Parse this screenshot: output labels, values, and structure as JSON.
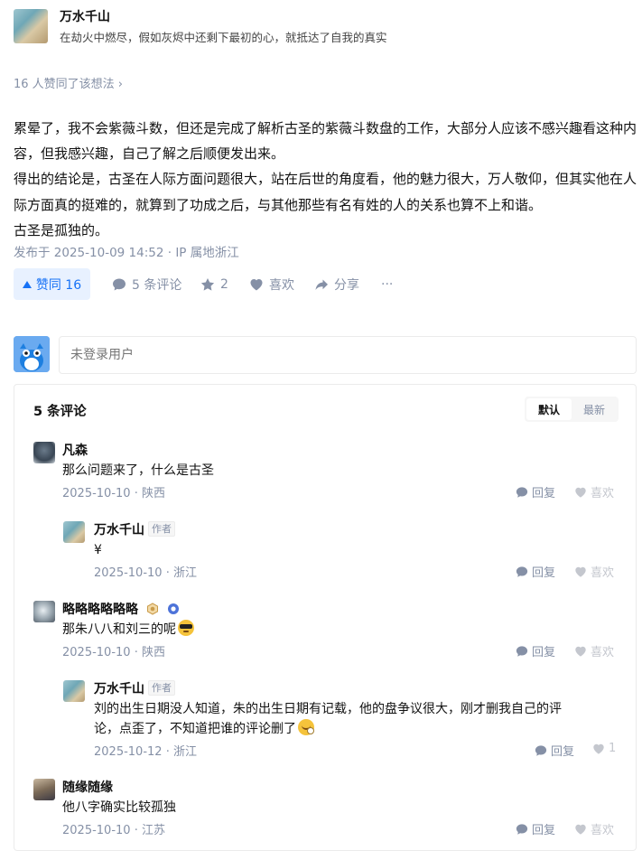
{
  "author": {
    "name": "万水千山",
    "bio": "在劫火中燃尽，假如灰烬中还剩下最初的心，就抵达了自我的真实"
  },
  "likers_text": "16 人赞同了该想法 ›",
  "content": {
    "p1": "累晕了，我不会紫薇斗数，但还是完成了解析古圣的紫薇斗数盘的工作，大部分人应该不感兴趣看这种内容，但我感兴趣，自己了解之后顺便发出来。",
    "p2": "得出的结论是，古圣在人际方面问题很大，站在后世的角度看，他的魅力很大，万人敬仰，但其实他在人际方面真的挺难的，就算到了功成之后，与其他那些有名有姓的人的关系也算不上和谐。",
    "p3": "古圣是孤独的。"
  },
  "meta": "发布于 2025-10-09 14:52 · IP 属地浙江",
  "actions": {
    "vote": "赞同 16",
    "comments": "5 条评论",
    "favorites": "2",
    "like": "喜欢",
    "share": "分享",
    "more": "···"
  },
  "comment_box": {
    "placeholder": "未登录用户"
  },
  "comments_panel": {
    "title": "5 条评论",
    "sort_default": "默认",
    "sort_latest": "最新",
    "reply_label": "回复",
    "like_label": "喜欢",
    "author_tag": "作者",
    "items": [
      {
        "name": "凡森",
        "text": "那么问题来了，什么是古圣",
        "date": "2025-10-10",
        "location": "陕西",
        "like": "喜欢"
      },
      {
        "name": "万水千山",
        "text": "¥",
        "date": "2025-10-10",
        "location": "浙江",
        "like": "喜欢"
      },
      {
        "name": "略略略略略略",
        "text": "那朱八八和刘三的呢",
        "date": "2025-10-10",
        "location": "陕西",
        "like": "喜欢"
      },
      {
        "name": "万水千山",
        "text_line1": "刘的出生日期没人知道，朱的出生日期有记载，他的盘争议很大，刚才删我自己的评",
        "text_line2": "论，点歪了，不知道把谁的评论删了",
        "date": "2025-10-12",
        "location": "浙江",
        "like": "1"
      },
      {
        "name": "随缘随缘",
        "text": "他八字确实比较孤独",
        "date": "2025-10-10",
        "location": "江苏",
        "like": "喜欢"
      }
    ]
  },
  "colors": {
    "accent": "#1772f6",
    "accent_bg": "#e8f1ff",
    "muted": "#8590a6"
  }
}
